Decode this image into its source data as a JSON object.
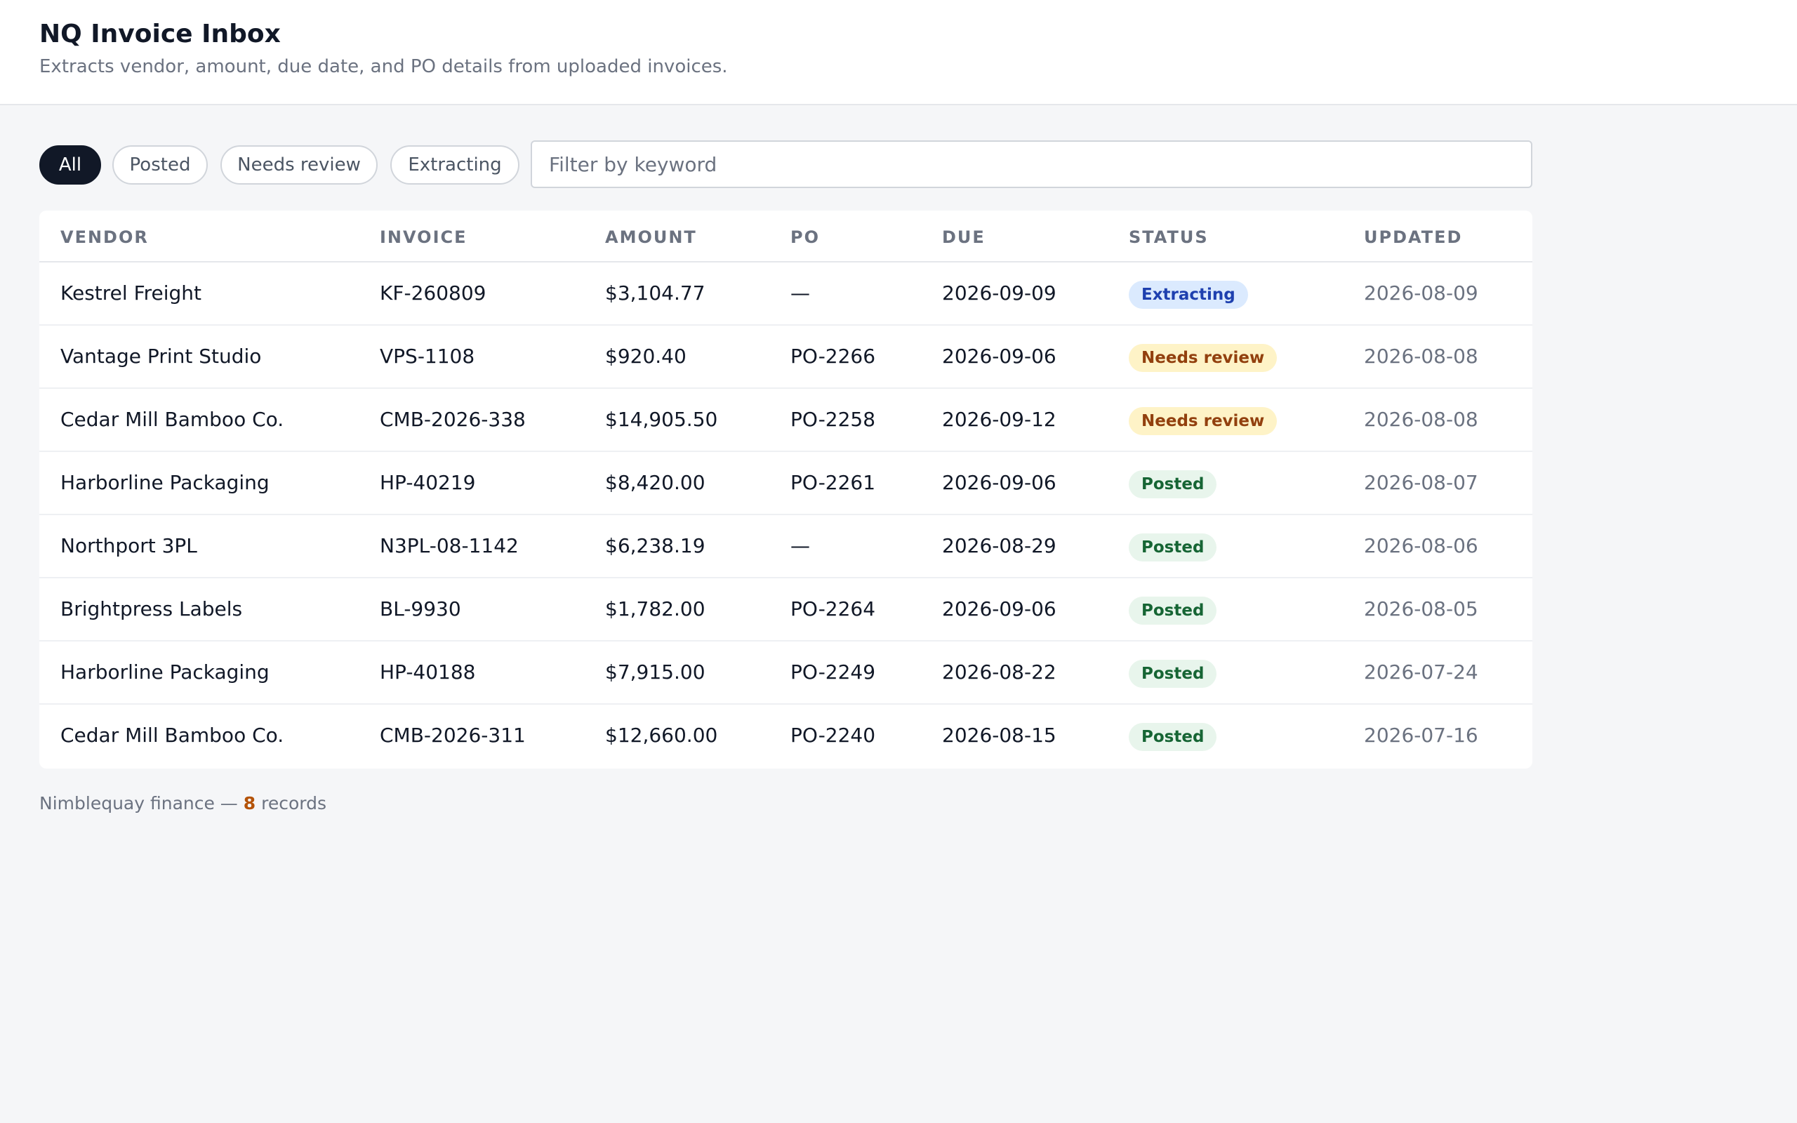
{
  "header": {
    "title": "NQ Invoice Inbox",
    "subtitle": "Extracts vendor, amount, due date, and PO details from uploaded invoices."
  },
  "filters": {
    "pills": [
      {
        "label": "All",
        "active": true
      },
      {
        "label": "Posted",
        "active": false
      },
      {
        "label": "Needs review",
        "active": false
      },
      {
        "label": "Extracting",
        "active": false
      }
    ],
    "search_placeholder": "Filter by keyword",
    "search_value": ""
  },
  "table": {
    "columns": [
      "VENDOR",
      "INVOICE",
      "AMOUNT",
      "PO",
      "DUE",
      "STATUS",
      "UPDATED"
    ],
    "rows": [
      {
        "vendor": "Kestrel Freight",
        "invoice": "KF-260809",
        "amount": "$3,104.77",
        "po": "—",
        "due": "2026-09-09",
        "status": "Extracting",
        "status_kind": "extracting",
        "updated": "2026-08-09"
      },
      {
        "vendor": "Vantage Print Studio",
        "invoice": "VPS-1108",
        "amount": "$920.40",
        "po": "PO-2266",
        "due": "2026-09-06",
        "status": "Needs review",
        "status_kind": "review",
        "updated": "2026-08-08"
      },
      {
        "vendor": "Cedar Mill Bamboo Co.",
        "invoice": "CMB-2026-338",
        "amount": "$14,905.50",
        "po": "PO-2258",
        "due": "2026-09-12",
        "status": "Needs review",
        "status_kind": "review",
        "updated": "2026-08-08"
      },
      {
        "vendor": "Harborline Packaging",
        "invoice": "HP-40219",
        "amount": "$8,420.00",
        "po": "PO-2261",
        "due": "2026-09-06",
        "status": "Posted",
        "status_kind": "posted",
        "updated": "2026-08-07"
      },
      {
        "vendor": "Northport 3PL",
        "invoice": "N3PL-08-1142",
        "amount": "$6,238.19",
        "po": "—",
        "due": "2026-08-29",
        "status": "Posted",
        "status_kind": "posted",
        "updated": "2026-08-06"
      },
      {
        "vendor": "Brightpress Labels",
        "invoice": "BL-9930",
        "amount": "$1,782.00",
        "po": "PO-2264",
        "due": "2026-09-06",
        "status": "Posted",
        "status_kind": "posted",
        "updated": "2026-08-05"
      },
      {
        "vendor": "Harborline Packaging",
        "invoice": "HP-40188",
        "amount": "$7,915.00",
        "po": "PO-2249",
        "due": "2026-08-22",
        "status": "Posted",
        "status_kind": "posted",
        "updated": "2026-07-24"
      },
      {
        "vendor": "Cedar Mill Bamboo Co.",
        "invoice": "CMB-2026-311",
        "amount": "$12,660.00",
        "po": "PO-2240",
        "due": "2026-08-15",
        "status": "Posted",
        "status_kind": "posted",
        "updated": "2026-07-16"
      }
    ]
  },
  "footer": {
    "prefix": "Nimblequay finance — ",
    "count": "8",
    "suffix": " records"
  },
  "colors": {
    "accent": "#111827",
    "extracting_bg": "#dbeafe",
    "extracting_fg": "#1e40af",
    "review_bg": "#fef3c7",
    "review_fg": "#92400e",
    "posted_bg": "#e8f5ec",
    "posted_fg": "#166534",
    "count": "#b45309"
  }
}
